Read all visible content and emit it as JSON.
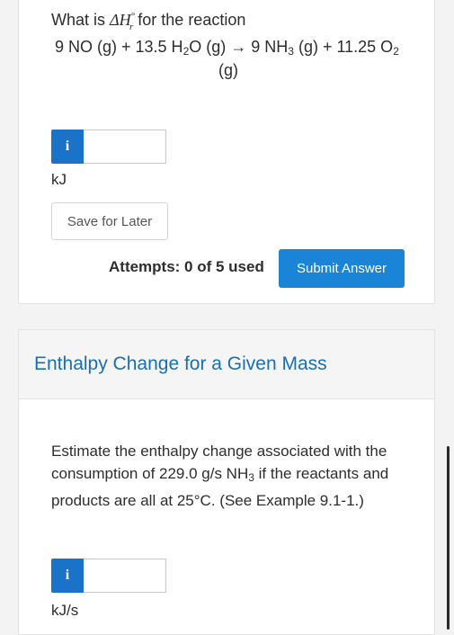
{
  "question1": {
    "prefix": "What is ",
    "symbol_delta": "ΔH",
    "symbol_sup": "°",
    "symbol_sub": "r",
    "suffix": " for the reaction",
    "eq_part1": "9 NO (g) + 13.5 H",
    "eq_sub1": "2",
    "eq_part2": "O (g) → 9 NH",
    "eq_sub2": "3",
    "eq_part3": " (g) + 11.25 O",
    "eq_sub3": "2",
    "eq_part4": "(g)",
    "info_icon_label": "i",
    "answer_value": "",
    "unit": "kJ",
    "save_label": "Save for Later",
    "attempts_label": "Attempts: 0 of 5 used",
    "submit_label": "Submit Answer"
  },
  "section2": {
    "title": "Enthalpy Change for a Given Mass",
    "text_part1": "Estimate the enthalpy change associated with the consumption of 229.0 g/s NH",
    "text_sub": "3",
    "text_part2": " if the reactants and products are all at 25°C. (See Example 9.1-1.)",
    "info_icon_label": "i",
    "answer_value": "",
    "unit": "kJ/s"
  },
  "colors": {
    "accent": "#1a85d6",
    "info": "#1a73c8",
    "title": "#1a6fb0"
  }
}
